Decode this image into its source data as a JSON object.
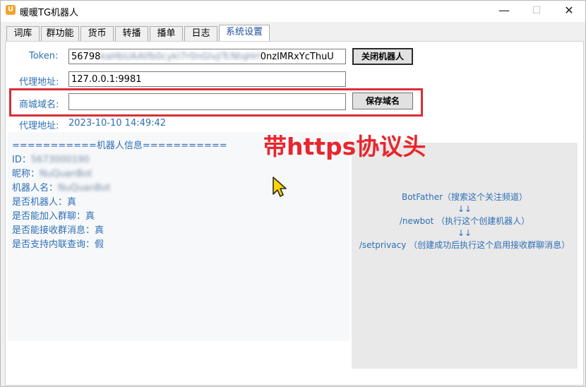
{
  "window": {
    "title": "暖暖TG机器人",
    "minimize_glyph": "—",
    "maximize_glyph": "☐",
    "close_glyph": "✕"
  },
  "tabs": [
    "词库",
    "群功能",
    "货币",
    "转播",
    "播单",
    "日志",
    "系统设置"
  ],
  "active_tab": "系统设置",
  "settings": {
    "token_label": "Token:",
    "token_prefix": "56798",
    "token_masked": "kaHbUAAtfb0cykl7r0nGlvjiTcNtqHrl",
    "token_suffix": "0nzIMRxYcThuU",
    "close_bot_button": "关闭机器人",
    "proxy_label": "代理地址:",
    "proxy_value": "127.0.0.1:9981",
    "shop_domain_label": "商城域名:",
    "shop_domain_value": "",
    "save_domain_button": "保存域名",
    "proxy_time_label": "代理地址:",
    "proxy_time_value": "2023-10-10 14:49:42"
  },
  "bot_info": {
    "header": "===========机器人信息===========",
    "id_label": "ID：",
    "id_value": "5673000190",
    "nickname_label": "昵称：",
    "nickname_value": "NuQuanBot",
    "username_label": "机器人名：",
    "username_value": "NuQuanBot",
    "is_bot": "是否机器人：真",
    "can_join_groups": "是否能加入群聊：真",
    "can_read_group_messages": "是否能接收群消息：真",
    "supports_inline_queries": "是否支持内联查询：假"
  },
  "guide": {
    "line1": "BotFather（搜索这个关注频道）",
    "arrow1": "↓↓",
    "line2": "/newbot （执行这个创建机器人）",
    "arrow2": "↓↓",
    "line3": "/setprivacy （创建成功后执行这个启用接收群聊消息）"
  },
  "annotation": "带https协议头",
  "colors": {
    "label_blue": "#2e6fb5",
    "highlight_red": "#d82f35",
    "annotation_red": "#e8262d",
    "cursor_yellow": "#ffd400"
  }
}
